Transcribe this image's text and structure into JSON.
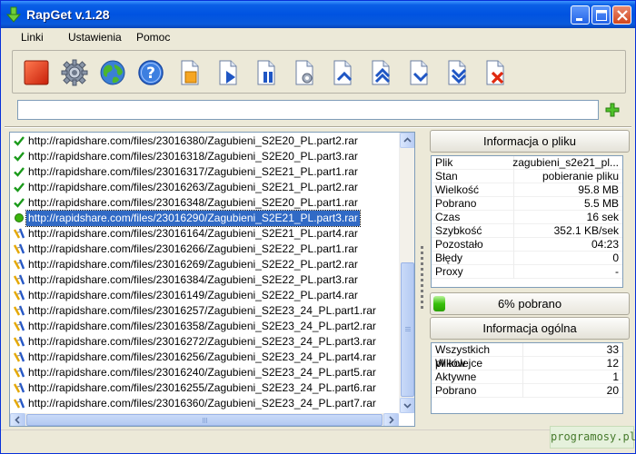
{
  "window": {
    "title": "RapGet v.1.28"
  },
  "menu": {
    "items": [
      "Linki",
      "Ustawienia",
      "Pomoc"
    ]
  },
  "toolbar": {
    "buttons": [
      "stop-icon",
      "settings-gear-icon",
      "globe-icon",
      "help-icon",
      "new-file-icon",
      "start-download-icon",
      "pause-download-icon",
      "file-settings-icon",
      "move-up-icon",
      "move-top-icon",
      "move-down-icon",
      "move-bottom-icon",
      "delete-icon"
    ]
  },
  "url_input": {
    "value": "",
    "placeholder": ""
  },
  "files": [
    {
      "status": "done",
      "url": "http://rapidshare.com/files/23016380/Zagubieni_S2E20_PL.part2.rar"
    },
    {
      "status": "done",
      "url": "http://rapidshare.com/files/23016318/Zagubieni_S2E20_PL.part3.rar"
    },
    {
      "status": "done",
      "url": "http://rapidshare.com/files/23016317/Zagubieni_S2E21_PL.part1.rar"
    },
    {
      "status": "done",
      "url": "http://rapidshare.com/files/23016263/Zagubieni_S2E21_PL.part2.rar"
    },
    {
      "status": "done",
      "url": "http://rapidshare.com/files/23016348/Zagubieni_S2E20_PL.part1.rar"
    },
    {
      "status": "active",
      "url": "http://rapidshare.com/files/23016290/Zagubieni_S2E21_PL.part3.rar",
      "selected": true
    },
    {
      "status": "queued",
      "url": "http://rapidshare.com/files/23016164/Zagubieni_S2E21_PL.part4.rar"
    },
    {
      "status": "queued",
      "url": "http://rapidshare.com/files/23016266/Zagubieni_S2E22_PL.part1.rar"
    },
    {
      "status": "queued",
      "url": "http://rapidshare.com/files/23016269/Zagubieni_S2E22_PL.part2.rar"
    },
    {
      "status": "queued",
      "url": "http://rapidshare.com/files/23016384/Zagubieni_S2E22_PL.part3.rar"
    },
    {
      "status": "queued",
      "url": "http://rapidshare.com/files/23016149/Zagubieni_S2E22_PL.part4.rar"
    },
    {
      "status": "queued",
      "url": "http://rapidshare.com/files/23016257/Zagubieni_S2E23_24_PL.part1.rar"
    },
    {
      "status": "queued",
      "url": "http://rapidshare.com/files/23016358/Zagubieni_S2E23_24_PL.part2.rar"
    },
    {
      "status": "queued",
      "url": "http://rapidshare.com/files/23016272/Zagubieni_S2E23_24_PL.part3.rar"
    },
    {
      "status": "queued",
      "url": "http://rapidshare.com/files/23016256/Zagubieni_S2E23_24_PL.part4.rar"
    },
    {
      "status": "queued",
      "url": "http://rapidshare.com/files/23016240/Zagubieni_S2E23_24_PL.part5.rar"
    },
    {
      "status": "queued",
      "url": "http://rapidshare.com/files/23016255/Zagubieni_S2E23_24_PL.part6.rar"
    },
    {
      "status": "queued",
      "url": "http://rapidshare.com/files/23016360/Zagubieni_S2E23_24_PL.part7.rar"
    }
  ],
  "file_info": {
    "header": "Informacja o pliku",
    "rows": [
      {
        "key": "Plik",
        "value": "zagubieni_s2e21_pl..."
      },
      {
        "key": "Stan",
        "value": "pobieranie pliku"
      },
      {
        "key": "Wielkość",
        "value": "95.8 MB"
      },
      {
        "key": "Pobrano",
        "value": "5.5 MB"
      },
      {
        "key": "Czas",
        "value": "16 sek"
      },
      {
        "key": "Szybkość",
        "value": "352.1 KB/sek"
      },
      {
        "key": "Pozostało",
        "value": "04:23"
      },
      {
        "key": "Błędy",
        "value": "0"
      },
      {
        "key": "Proxy",
        "value": "-"
      }
    ]
  },
  "progress": {
    "percent": 6,
    "label": "6% pobrano",
    "color": "#39c10c"
  },
  "general_info": {
    "header": "Informacja ogólna",
    "rows": [
      {
        "key": "Wszystkich plików",
        "value": "33"
      },
      {
        "key": "W kolejce",
        "value": "12"
      },
      {
        "key": "Aktywne",
        "value": "1"
      },
      {
        "key": "Pobrano",
        "value": "20"
      }
    ]
  },
  "brand": {
    "text": "programosy.pl"
  },
  "colors": {
    "title_bar": "#0053e1",
    "selection": "#316ac5",
    "done": "#1a9a1a",
    "active": "#3cb30c"
  }
}
